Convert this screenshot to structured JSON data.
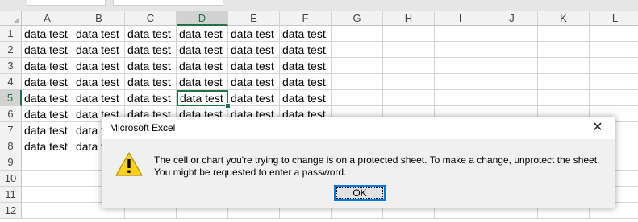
{
  "columns": [
    "A",
    "B",
    "C",
    "D",
    "E",
    "F",
    "G",
    "H",
    "I",
    "J",
    "K",
    "L"
  ],
  "rows": [
    "1",
    "2",
    "3",
    "4",
    "5",
    "6",
    "7",
    "8",
    "9",
    "10",
    "11",
    "12"
  ],
  "cell_value": "data test",
  "dialog": {
    "title": "Microsoft Excel",
    "close_glyph": "✕",
    "message": "The cell or chart you're trying to change is on a protected sheet. To make a change, unprotect the sheet. You might be requested to enter a password.",
    "ok_label": "OK",
    "icon": "warning-icon"
  },
  "colors": {
    "accent": "#217346",
    "dialog_border": "#1883d7",
    "warning": "#fcd116"
  }
}
